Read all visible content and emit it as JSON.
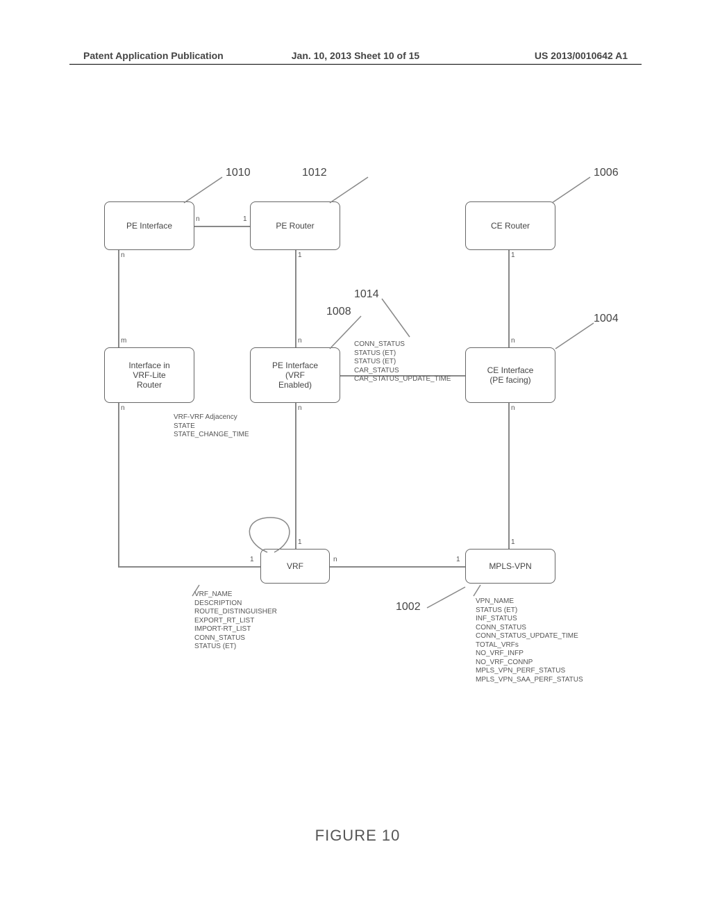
{
  "header": {
    "left": "Patent Application Publication",
    "center": "Jan. 10, 2013  Sheet 10 of 15",
    "right": "US 2013/0010642 A1"
  },
  "figure_caption": "FIGURE 10",
  "boxes": {
    "pe_interface": {
      "label": "PE Interface",
      "ref": "1010"
    },
    "pe_router": {
      "label": "PE Router",
      "ref": "1012"
    },
    "ce_router": {
      "label": "CE Router",
      "ref": "1006"
    },
    "vrf_lite": {
      "label": "Interface in\nVRF-Lite\nRouter",
      "ref": ""
    },
    "pe_if_vrf": {
      "label": "PE Interface\n(VRF\nEnabled)",
      "ref": "1008"
    },
    "ce_if_pe": {
      "label": "CE Interface\n(PE facing)",
      "ref": "1004"
    },
    "vrf": {
      "label": "VRF",
      "ref": ""
    },
    "mpls_vpn": {
      "label": "MPLS-VPN",
      "ref": "1002"
    }
  },
  "edge_labels": {
    "conn_link": "CONN_STATUS\nSTATUS (ET)\nSTATUS (ET)\nCAR_STATUS\nCAR_STATUS_UPDATE_TIME",
    "conn_link_ref": "1014",
    "vrf_adj": "VRF-VRF Adjacency\nSTATE\nSTATE_CHANGE_TIME"
  },
  "card": {
    "pe_if_pe_router_left": "n",
    "pe_if_pe_router_right": "1",
    "pe_if_vrflite_top": "n",
    "pe_if_vrflite_bottom": "m",
    "pe_router_pe_ifvrf_top": "1",
    "pe_router_pe_ifvrf_bottom": "n",
    "ce_router_ce_if_top": "1",
    "ce_router_ce_if_bottom": "n",
    "vrflite_vrf_top": "n",
    "vrflite_vrf_bottom": "1",
    "peifvrf_vrf_top": "n",
    "peifvrf_vrf_bottom": "1",
    "ceif_mpls_top": "n",
    "ceif_mpls_bottom": "1",
    "vrf_mpls_left": "n",
    "vrf_mpls_right": "1"
  },
  "vrf_attrs": "VRF_NAME\nDESCRIPTION\nROUTE_DISTINGUISHER\nEXPORT_RT_LIST\nIMPORT-RT_LIST\nCONN_STATUS\nSTATUS (ET)",
  "mpls_attrs": "VPN_NAME\nSTATUS (ET)\nINF_STATUS\nCONN_STATUS\nCONN_STATUS_UPDATE_TIME\nTOTAL_VRFs\nNO_VRF_INFP\nNO_VRF_CONNP\nMPLS_VPN_PERF_STATUS\nMPLS_VPN_SAA_PERF_STATUS"
}
